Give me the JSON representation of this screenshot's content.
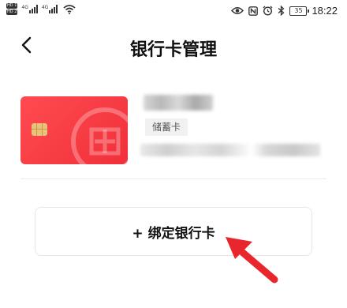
{
  "status_bar": {
    "sim1": "HD 1",
    "sim2": "HD 2",
    "net1": "4G",
    "net2": "4G",
    "battery": "35",
    "time": "18:22",
    "icons": [
      "eye-icon",
      "nfc-icon",
      "alarm-icon",
      "bluetooth-icon"
    ]
  },
  "header": {
    "title": "银行卡管理"
  },
  "card": {
    "type_label": "储蓄卡",
    "colors": {
      "card": "#f23a40",
      "chip": "#e8c27b"
    }
  },
  "actions": {
    "add_card_label": "+ 绑定银行卡"
  },
  "annotation": {
    "arrow_color": "#e8262b"
  }
}
